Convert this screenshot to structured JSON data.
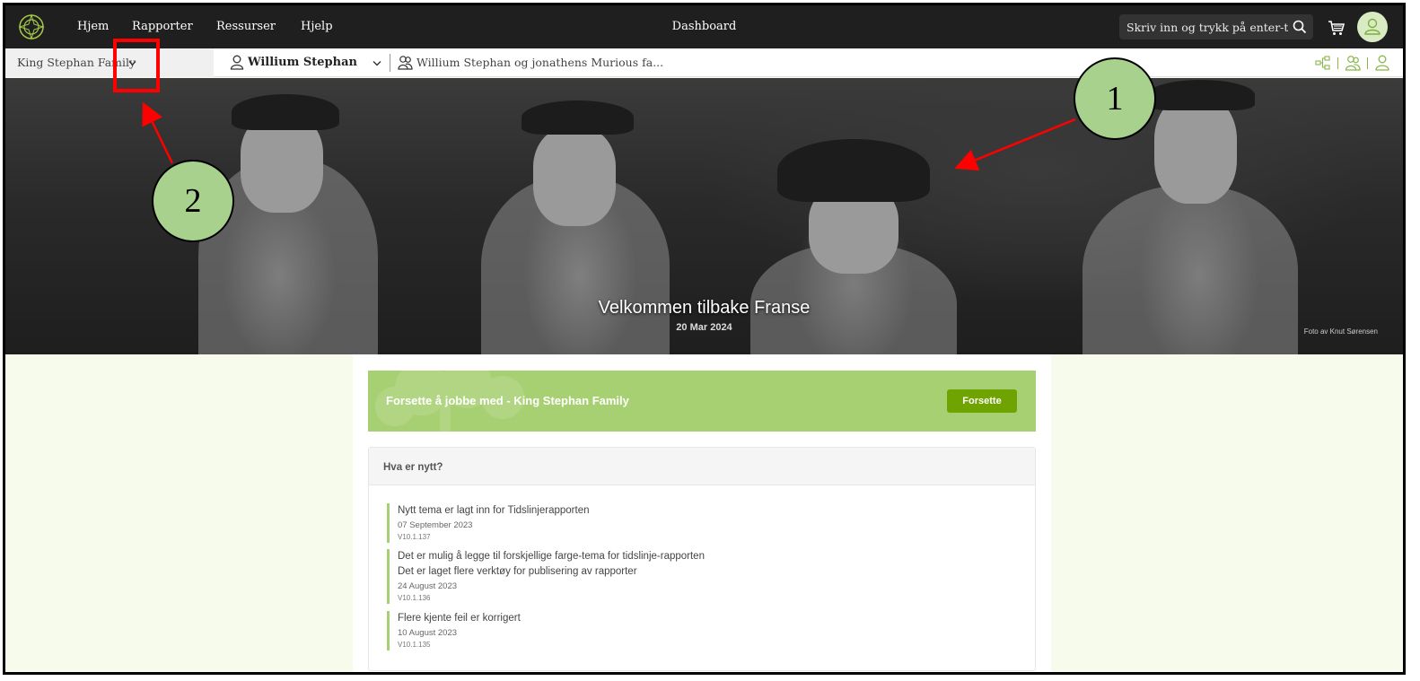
{
  "nav": {
    "links": [
      "Hjem",
      "Rapporter",
      "Ressurser",
      "Hjelp"
    ],
    "center_title": "Dashboard",
    "search_placeholder": "Skriv inn og trykk på enter-tasten"
  },
  "subbar": {
    "tree_name": "King Stephan Family",
    "person_name": "Willium Stephan",
    "family_name": "Willium Stephan og jonathens Murious fa..."
  },
  "hero": {
    "title": "Velkommen tilbake Franse",
    "date": "20 Mar 2024",
    "credit": "Foto av Knut Sørensen"
  },
  "callouts": [
    "1",
    "2"
  ],
  "banner": {
    "text": "Forsette å jobbe med - King Stephan Family",
    "button": "Forsette"
  },
  "news": {
    "heading": "Hva er nytt?",
    "items": [
      {
        "titles": [
          "Nytt tema er lagt inn for Tidslinjerapporten"
        ],
        "date": "07 September 2023",
        "version": "V10.1.137"
      },
      {
        "titles": [
          "Det er mulig å legge til forskjellige farge-tema for tidslinje-rapporten",
          "Det er laget flere verktøy for publisering av rapporter"
        ],
        "date": "24 August 2023",
        "version": "V10.1.136"
      },
      {
        "titles": [
          "Flere kjente feil er korrigert"
        ],
        "date": "10 August 2023",
        "version": "V10.1.135"
      }
    ]
  },
  "colors": {
    "accent": "#a7d073",
    "button": "#6ea300",
    "nav_bg": "#1f1f1f",
    "annotation_red": "#ff0000"
  }
}
